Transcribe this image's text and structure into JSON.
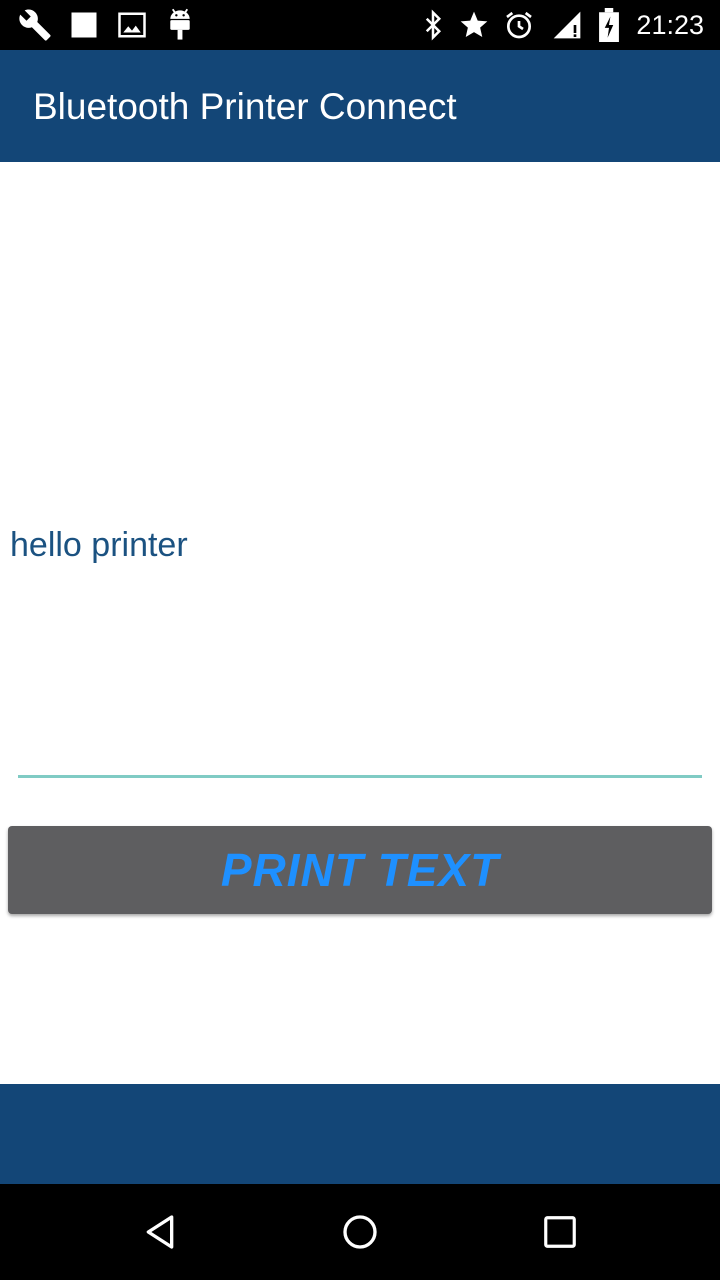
{
  "status_bar": {
    "time": "21:23",
    "left_icons": [
      "wrench-icon",
      "square-icon",
      "image-icon",
      "android-icon"
    ],
    "right_icons": [
      "bluetooth-icon",
      "star-icon",
      "alarm-icon",
      "signal-icon",
      "battery-charging-icon"
    ]
  },
  "app_bar": {
    "title": "Bluetooth Printer Connect",
    "color": "#134677"
  },
  "main": {
    "text_field_value": "hello printer",
    "underline_color": "#80cbc4",
    "print_button_label": "PRINT TEXT",
    "print_button_color": "#5e5e60",
    "print_button_text_color": "#1e90ff"
  },
  "nav_bar": {
    "buttons": [
      "back-icon",
      "home-icon",
      "recents-icon"
    ]
  }
}
